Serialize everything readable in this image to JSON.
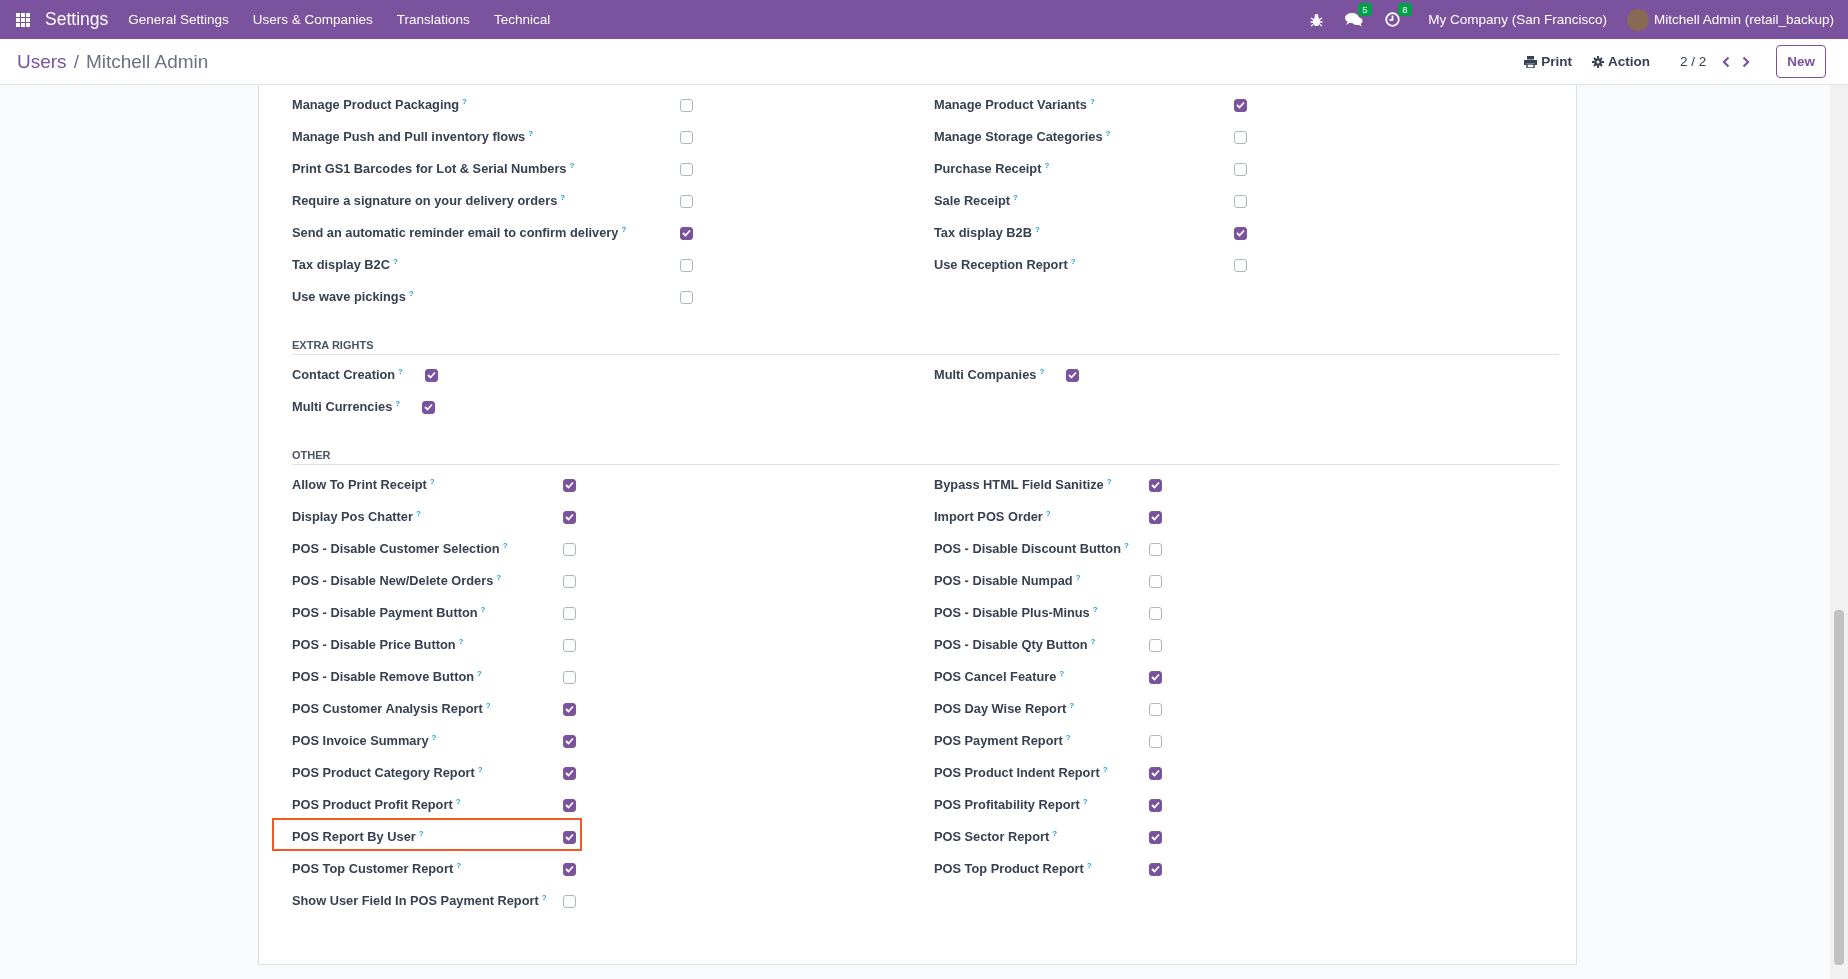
{
  "navbar": {
    "app_name": "Settings",
    "menu": [
      "General Settings",
      "Users & Companies",
      "Translations",
      "Technical"
    ],
    "messages_badge": "5",
    "activities_badge": "8",
    "company": "My Company (San Francisco)",
    "user": "Mitchell Admin (retail_backup)"
  },
  "breadcrumb": {
    "parent": "Users",
    "separator": "/",
    "current": "Mitchell Admin"
  },
  "actions": {
    "print": "Print",
    "action": "Action",
    "pager": "2 / 2",
    "new_button": "New"
  },
  "sections": [
    {
      "kind": "long_labels",
      "items": [
        {
          "label": "Manage Product Packaging",
          "help": "?",
          "checked": false,
          "highlighted": false
        },
        {
          "label": "Manage Product Variants",
          "help": "?",
          "checked": true,
          "highlighted": false
        },
        {
          "label": "Manage Push and Pull inventory flows",
          "help": "?",
          "checked": false,
          "highlighted": false
        },
        {
          "label": "Manage Storage Categories",
          "help": "?",
          "checked": false,
          "highlighted": false
        },
        {
          "label": "Print GS1 Barcodes for Lot & Serial Numbers",
          "help": "?",
          "checked": false,
          "highlighted": false
        },
        {
          "label": "Purchase Receipt",
          "help": "?",
          "checked": false,
          "highlighted": false
        },
        {
          "label": "Require a signature on your delivery orders",
          "help": "?",
          "checked": false,
          "highlighted": false
        },
        {
          "label": "Sale Receipt",
          "help": "?",
          "checked": false,
          "highlighted": false
        },
        {
          "label": "Send an automatic reminder email to confirm delivery",
          "help": "?",
          "checked": true,
          "highlighted": false
        },
        {
          "label": "Tax display B2B",
          "help": "?",
          "checked": true,
          "highlighted": false
        },
        {
          "label": "Tax display B2C",
          "help": "?",
          "checked": false,
          "highlighted": false
        },
        {
          "label": "Use Reception Report",
          "help": "?",
          "checked": false,
          "highlighted": false
        },
        {
          "label": "Use wave pickings",
          "help": "?",
          "checked": false,
          "highlighted": false
        }
      ]
    },
    {
      "kind": "inline",
      "title": "EXTRA RIGHTS",
      "items": [
        {
          "label": "Contact Creation",
          "help": "?",
          "checked": true,
          "highlighted": false
        },
        {
          "label": "Multi Companies",
          "help": "?",
          "checked": true,
          "highlighted": false
        },
        {
          "label": "Multi Currencies",
          "help": "?",
          "checked": true,
          "highlighted": false
        }
      ]
    },
    {
      "kind": "short_labels",
      "title": "OTHER",
      "items": [
        {
          "label": "Allow To Print Receipt",
          "help": "?",
          "checked": true,
          "highlighted": false
        },
        {
          "label": "Bypass HTML Field Sanitize",
          "help": "?",
          "checked": true,
          "highlighted": false
        },
        {
          "label": "Display Pos Chatter",
          "help": "?",
          "checked": true,
          "highlighted": false
        },
        {
          "label": "Import POS Order",
          "help": "?",
          "checked": true,
          "highlighted": false
        },
        {
          "label": "POS - Disable Customer Selection",
          "help": "?",
          "checked": false,
          "highlighted": false
        },
        {
          "label": "POS - Disable Discount Button",
          "help": "?",
          "checked": false,
          "highlighted": false
        },
        {
          "label": "POS - Disable New/Delete Orders",
          "help": "?",
          "checked": false,
          "highlighted": false
        },
        {
          "label": "POS - Disable Numpad",
          "help": "?",
          "checked": false,
          "highlighted": false
        },
        {
          "label": "POS - Disable Payment Button",
          "help": "?",
          "checked": false,
          "highlighted": false
        },
        {
          "label": "POS - Disable Plus-Minus",
          "help": "?",
          "checked": false,
          "highlighted": false
        },
        {
          "label": "POS - Disable Price Button",
          "help": "?",
          "checked": false,
          "highlighted": false
        },
        {
          "label": "POS - Disable Qty Button",
          "help": "?",
          "checked": false,
          "highlighted": false
        },
        {
          "label": "POS - Disable Remove Button",
          "help": "?",
          "checked": false,
          "highlighted": false
        },
        {
          "label": "POS Cancel Feature",
          "help": "?",
          "checked": true,
          "highlighted": false
        },
        {
          "label": "POS Customer Analysis Report",
          "help": "?",
          "checked": true,
          "highlighted": false
        },
        {
          "label": "POS Day Wise Report",
          "help": "?",
          "checked": false,
          "highlighted": false
        },
        {
          "label": "POS Invoice Summary",
          "help": "?",
          "checked": true,
          "highlighted": false
        },
        {
          "label": "POS Payment Report",
          "help": "?",
          "checked": false,
          "highlighted": false
        },
        {
          "label": "POS Product Category Report",
          "help": "?",
          "checked": true,
          "highlighted": false
        },
        {
          "label": "POS Product Indent Report",
          "help": "?",
          "checked": true,
          "highlighted": false
        },
        {
          "label": "POS Product Profit Report",
          "help": "?",
          "checked": true,
          "highlighted": false
        },
        {
          "label": "POS Profitability Report",
          "help": "?",
          "checked": true,
          "highlighted": false
        },
        {
          "label": "POS Report By User",
          "help": "?",
          "checked": true,
          "highlighted": true
        },
        {
          "label": "POS Sector Report",
          "help": "?",
          "checked": true,
          "highlighted": false
        },
        {
          "label": "POS Top Customer Report",
          "help": "?",
          "checked": true,
          "highlighted": false
        },
        {
          "label": "POS Top Product Report",
          "help": "?",
          "checked": true,
          "highlighted": false
        },
        {
          "label": "Show User Field In POS Payment Report",
          "help": "?",
          "checked": false,
          "highlighted": false
        }
      ]
    }
  ]
}
